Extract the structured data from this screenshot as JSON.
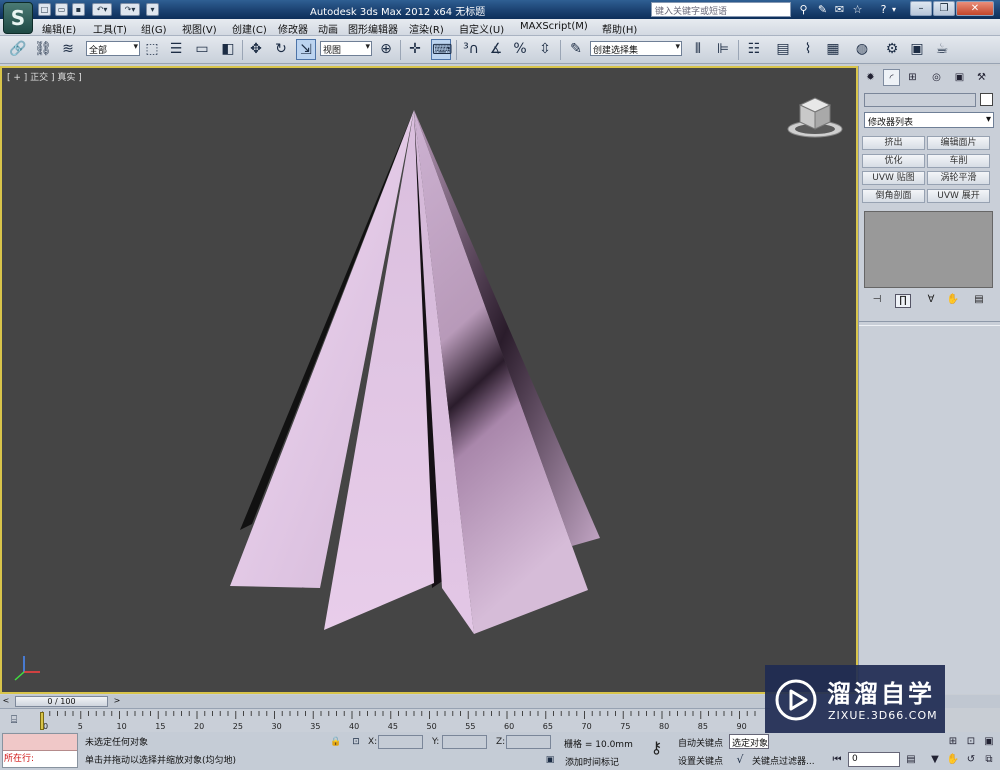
{
  "titlebar": {
    "title": "Autodesk 3ds Max  2012 x64        无标题",
    "search_placeholder": "键入关键字或短语"
  },
  "menubar": {
    "items": [
      "编辑(E)",
      "工具(T)",
      "组(G)",
      "视图(V)",
      "创建(C)",
      "修改器",
      "动画",
      "图形编辑器",
      "渲染(R)",
      "自定义(U)",
      "MAXScript(M)",
      "帮助(H)"
    ]
  },
  "toolbar": {
    "filter_value": "全部",
    "refcoord_value": "视图",
    "named_selection_value": "创建选择集"
  },
  "viewport": {
    "label": "[ + ] 正交 ] 真实 ]",
    "background": "#454545",
    "border_color": "#d8c44a",
    "model_color": "#e6c8e8"
  },
  "command_panel": {
    "modifier_list": "修改器列表",
    "buttons": [
      "挤出",
      "编辑面片",
      "优化",
      "车削",
      "UVW 贴图",
      "涡轮平滑",
      "倒角剖面",
      "UVW 展开"
    ]
  },
  "timeslider": {
    "position_label": "0 / 100"
  },
  "trackbar": {
    "ticks": [
      "0",
      "5",
      "10",
      "15",
      "20",
      "25",
      "30",
      "35",
      "40",
      "45",
      "50",
      "55",
      "60",
      "65",
      "70",
      "75",
      "80",
      "85",
      "90"
    ]
  },
  "statusbar": {
    "maxscript_label": "所在行:",
    "status_text": "未选定任何对象",
    "prompt_text": "单击并拖动以选择并缩放对象(均匀地)",
    "x_label": "X:",
    "y_label": "Y:",
    "z_label": "Z:",
    "grid_text": "栅格 = 10.0mm",
    "time_tag": "添加时间标记",
    "auto_key": "自动关键点",
    "selected_value": "选定对象",
    "set_key": "设置关键点",
    "key_filters": "关键点过滤器...",
    "frame_value": "0"
  },
  "watermark": {
    "title": "溜溜自学",
    "subtitle": "ZIXUE.3D66.COM"
  }
}
